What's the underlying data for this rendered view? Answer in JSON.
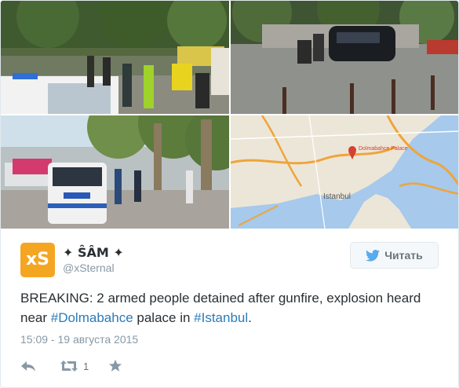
{
  "author": {
    "display_name": "✦ ŜÂM ✦",
    "handle": "@xSternal",
    "avatar_text": "xS"
  },
  "follow_button": {
    "label": "Читать"
  },
  "tweet": {
    "text_before": "BREAKING: 2 armed people detained after gunfire, explosion heard near ",
    "hashtag1": "#Dolmabahce",
    "text_middle": " palace in ",
    "hashtag2": "#Istanbul",
    "text_after": "."
  },
  "timestamp": "15:09 - 19 августа 2015",
  "actions": {
    "retweet_count": "1"
  },
  "map": {
    "city_label": "Istanbul",
    "marker_label": "Dolmabahce Palace"
  },
  "colors": {
    "link": "#2b7bb9",
    "twitter_blue": "#55acee",
    "text": "#292f33",
    "muted": "#8899a6",
    "avatar": "#f4a623"
  }
}
